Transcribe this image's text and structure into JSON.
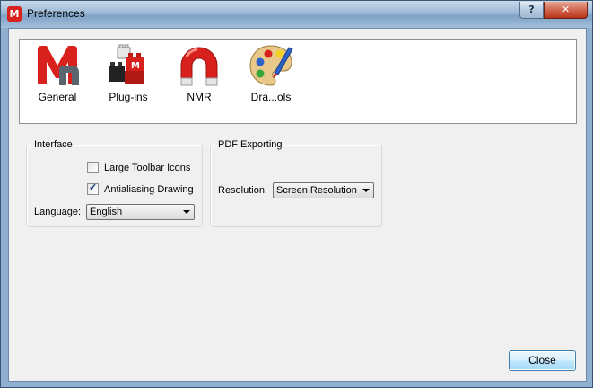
{
  "window": {
    "title": "Preferences",
    "app_icon_letter": "M",
    "help_label": "?",
    "close_label": "✕"
  },
  "toolbar": {
    "items": [
      {
        "label": "General",
        "icon": "mnova-logo-icon"
      },
      {
        "label": "Plug-ins",
        "icon": "plugin-blocks-icon"
      },
      {
        "label": "NMR",
        "icon": "magnet-icon"
      },
      {
        "label": "Dra...ols",
        "icon": "palette-icon"
      }
    ]
  },
  "interface": {
    "title": "Interface",
    "large_toolbar_icons": {
      "label": "Large Toolbar Icons",
      "checked": false
    },
    "antialiasing_drawing": {
      "label": "Antialiasing Drawing",
      "checked": true
    },
    "language": {
      "label": "Language:",
      "value": "English"
    }
  },
  "pdf_exporting": {
    "title": "PDF Exporting",
    "resolution": {
      "label": "Resolution:",
      "value": "Screen Resolution"
    }
  },
  "footer": {
    "close_label": "Close"
  },
  "colors": {
    "accent_red": "#d8201c",
    "titlebar_blue": "#9cb9d6"
  }
}
